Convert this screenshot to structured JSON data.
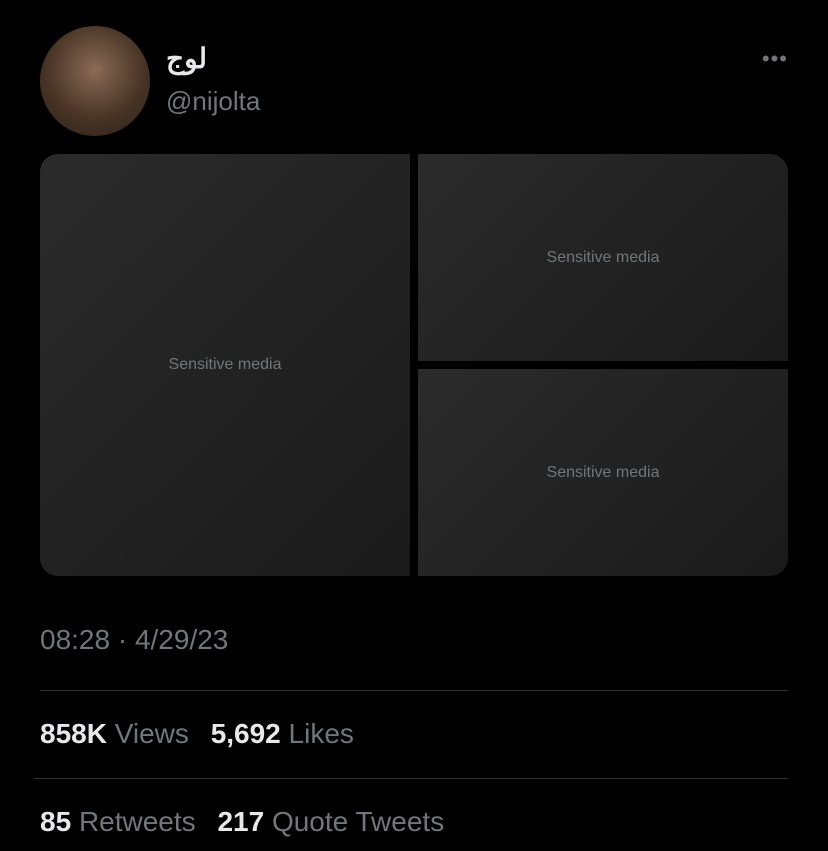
{
  "tweet": {
    "display_name": "لوج",
    "handle": "@nijolta",
    "more_icon": "more-horizontal-icon",
    "media_placeholder": "Sensitive media",
    "timestamp": "08:28 · 4/29/23"
  },
  "stats": {
    "views_count": "858K",
    "views_label": "Views",
    "likes_count": "5,692",
    "likes_label": "Likes",
    "retweets_count": "85",
    "retweets_label": "Retweets",
    "quotes_count": "217",
    "quotes_label": "Quote Tweets"
  }
}
